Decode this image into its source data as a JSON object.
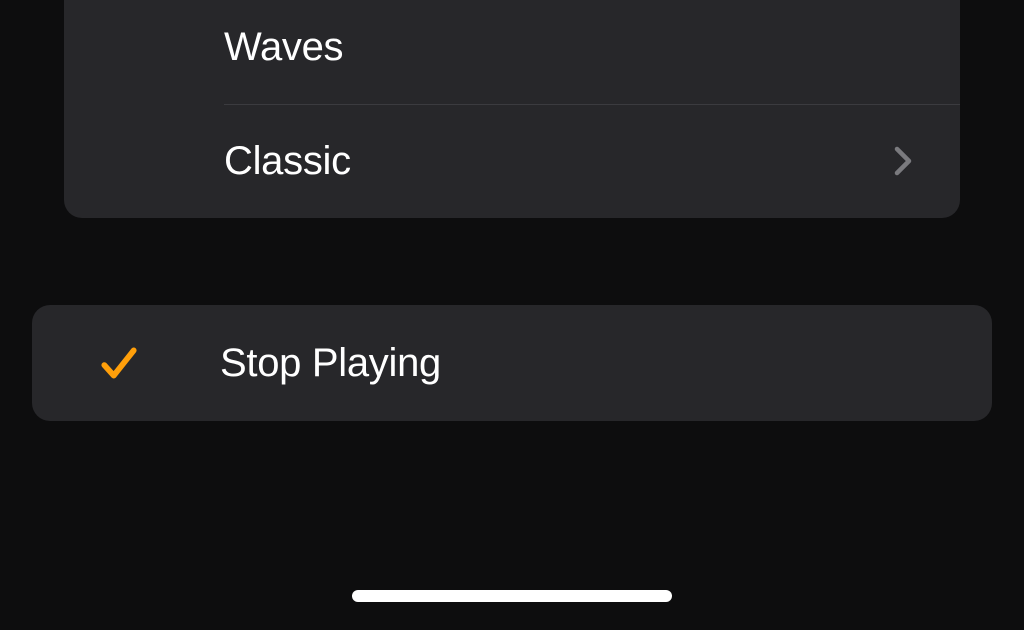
{
  "sounds": {
    "items": [
      {
        "label": "Waves",
        "hasChevron": false
      },
      {
        "label": "Classic",
        "hasChevron": true
      }
    ]
  },
  "selected": {
    "label": "Stop Playing",
    "checked": true
  },
  "colors": {
    "accent": "#ff9f0a",
    "chevron": "#7a7a7e"
  }
}
